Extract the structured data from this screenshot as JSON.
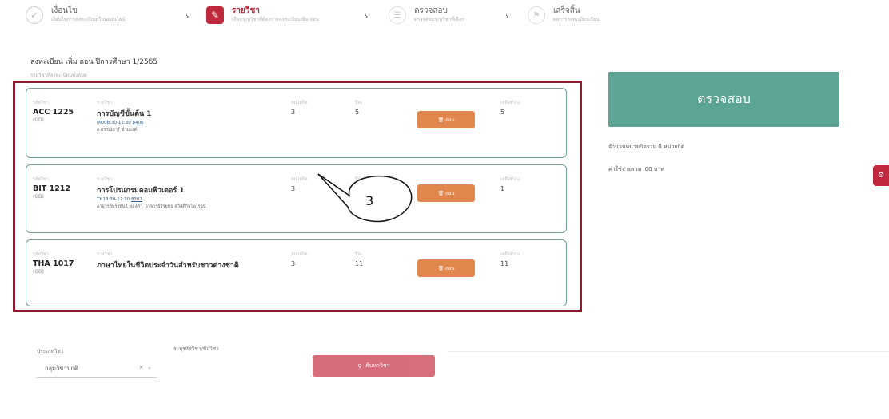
{
  "stepper": {
    "steps": [
      {
        "title": "เงื่อนไข",
        "subtitle": "เงื่อนไขการลงทะเบียนเรียนออนไลน์"
      },
      {
        "title": "รายวิชา",
        "subtitle": "เลือกรายวิชาที่ต้องการลงทะเบียนเพิ่ม ถอน"
      },
      {
        "title": "ตรวจสอบ",
        "subtitle": "ตรวจสอบรายวิชาที่เลือก"
      },
      {
        "title": "เสร็จสิ้น",
        "subtitle": "ผลการลงทะเบียนเรียน"
      }
    ],
    "icons": {
      "done": "check-icon",
      "active": "edit-icon",
      "pending": "list-icon"
    }
  },
  "page": {
    "title": "ลงทะเบียน เพิ่ม ถอน ปีการศึกษา 1/2565",
    "subtitle": "รายวิชาที่ลงทะเบียนทั้งหมด"
  },
  "labels": {
    "code": "รหัสวิชา",
    "name": "รายวิชา",
    "credit": "หน่วยกิต",
    "group": "ปีละ",
    "seats": "เหลือที่ว่าง"
  },
  "courses": [
    {
      "code": "ACC 1225",
      "group": "(GD)",
      "name": "การบัญชีขั้นต้น 1",
      "time": "MO08:30-12:30",
      "room": "8406",
      "teacher": "อ.กรรณิการ์ ขำมะงค์",
      "credit": "3",
      "section": "5",
      "seats": "5",
      "remove_label": "ถอน"
    },
    {
      "code": "BIT 1212",
      "group": "(GD)",
      "name": "การโปรแกรมคอมพิวเตอร์ 1",
      "time": "TH13:30-17:30",
      "room": "8307",
      "teacher": "อาจารย์ทรงพันธ์ ทองคำ, อาจารย์วิรยุทธ สวัสดิ์กิจไพโรจน์",
      "credit": "3",
      "section": "1",
      "seats": "1",
      "remove_label": "ถอน"
    },
    {
      "code": "THA 1017",
      "group": "(GD)",
      "name": "ภาษาไทยในชีวิตประจำวันสำหรับชาวต่างชาติ",
      "time": "",
      "room": "",
      "teacher": "",
      "credit": "3",
      "section": "11",
      "seats": "11",
      "remove_label": "ถอน"
    }
  ],
  "annotation": {
    "number": "3"
  },
  "summary": {
    "verify_label": "ตรวจสอบ",
    "credit_text": "จำนวนหน่วยกิตรวม 0 หน่วยกิต",
    "fee_text": "ค่าใช้จ่ายรวม .00 บาท"
  },
  "search": {
    "type_label": "ประเภทวิชา",
    "type_value": "กลุ่มวิชาปกติ",
    "code_label": "ระบุรหัสวิชา/ชื่อวิชา",
    "code_placeholder": "",
    "button_label": "ค้นหาวิชา"
  },
  "colors": {
    "primary": "#c0283e",
    "verify": "#5ca595",
    "remove": "#e0874d",
    "card_border": "#6f9d97",
    "frame": "#8b1d33"
  }
}
